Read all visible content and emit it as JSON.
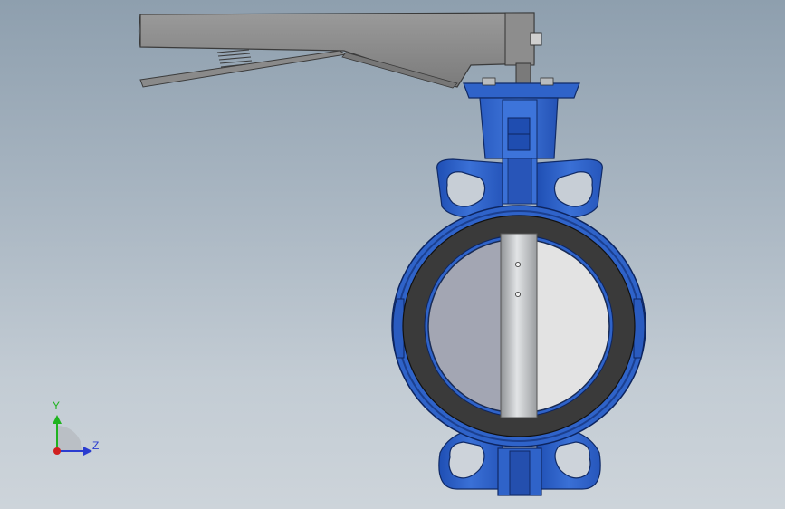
{
  "scene": {
    "background_top": "#8e9fae",
    "background_bottom": "#cdd4da",
    "body_color": "#2f63c9",
    "body_shadow_color": "#1b3f8f",
    "liner_color": "#3a3a3a",
    "disc_left_color": "#a3a6b3",
    "disc_right_color": "#e3e3e3",
    "stem_color": "#bfc2c4",
    "handle_color": "#8c8c8c"
  },
  "triad": {
    "y_label": "Y",
    "z_label": "Z",
    "y_color": "#1fb31f",
    "z_color": "#2a3cd0",
    "x_color": "#d02020"
  }
}
